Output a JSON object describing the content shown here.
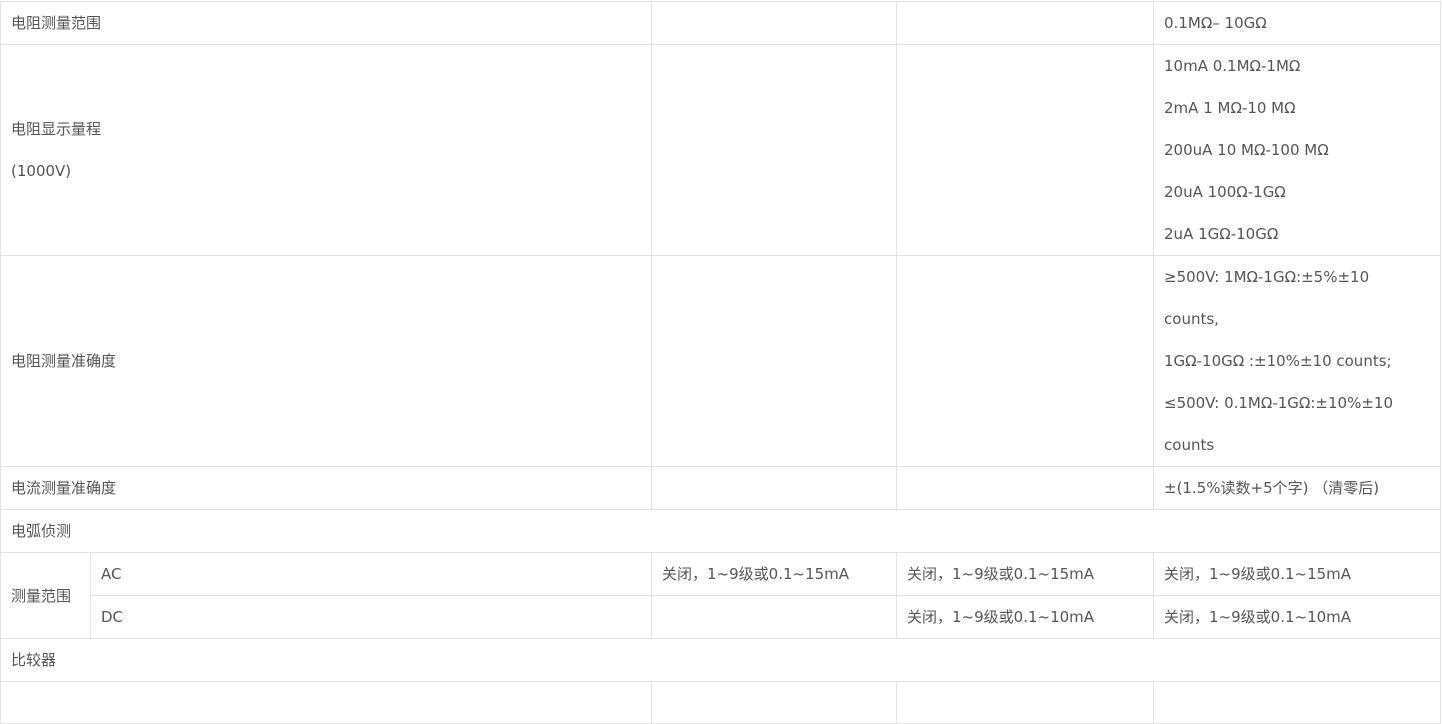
{
  "rows": {
    "range": {
      "label": "电阻测量范围",
      "value": "0.1MΩ– 10GΩ"
    },
    "display": {
      "label_line1": "电阻显示量程",
      "label_line2": "(1000V)",
      "lines": [
        "10mA 0.1MΩ-1MΩ",
        "2mA 1 MΩ-10 MΩ",
        "200uA 10 MΩ-100 MΩ",
        "20uA 100Ω-1GΩ",
        "2uA 1GΩ-10GΩ"
      ]
    },
    "accuracy": {
      "label": "电阻测量准确度",
      "lines": [
        "≥500V: 1MΩ-1GΩ:±5%±10",
        "counts,",
        "1GΩ-10GΩ :±10%±10 counts;",
        "≤500V: 0.1MΩ-1GΩ:±10%±10",
        "counts"
      ]
    },
    "current_accuracy": {
      "label": "电流测量准确度",
      "value": "±(1.5%读数+5个字) （清零后)"
    },
    "arc_section": {
      "label": "电弧侦测"
    },
    "measure_range": {
      "label": "测量范围",
      "ac": {
        "label": "AC",
        "col2": "关闭，1~9级或0.1~15mA",
        "col3": "关闭，1~9级或0.1~15mA",
        "col4": "关闭，1~9级或0.1~15mA"
      },
      "dc": {
        "label": "DC",
        "col2": "",
        "col3": "关闭，1~9级或0.1~10mA",
        "col4": "关闭，1~9级或0.1~10mA"
      }
    },
    "comparator": {
      "label": "比较器"
    }
  }
}
